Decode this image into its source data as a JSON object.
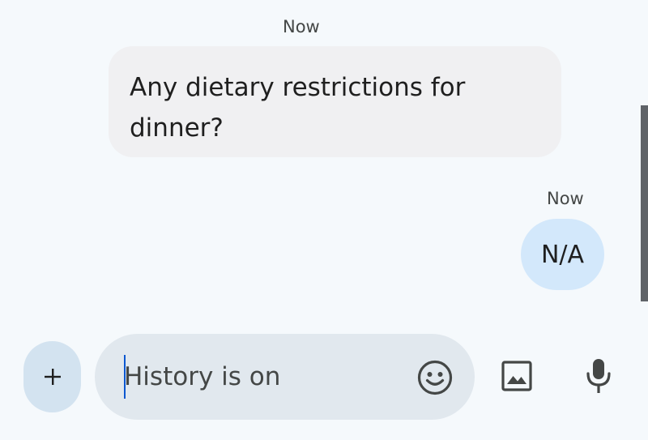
{
  "conversation": {
    "messages": [
      {
        "direction": "incoming",
        "timestamp": "Now",
        "text": "Any dietary restrictions for dinner?"
      },
      {
        "direction": "outgoing",
        "timestamp": "Now",
        "text": "N/A"
      }
    ]
  },
  "composer": {
    "placeholder": "History is on",
    "value": "",
    "attach_icon": "plus-icon",
    "emoji_icon": "emoji-icon",
    "gallery_icon": "image-icon",
    "voice_icon": "microphone-icon"
  },
  "colors": {
    "background": "#f5f9fc",
    "incoming_bubble": "#f0f0f2",
    "outgoing_bubble": "#d3e8fb",
    "composer_bg": "#e1e8ee",
    "plus_button_bg": "#d3e3f0",
    "caret": "#0b57d0",
    "icon": "#444746"
  }
}
